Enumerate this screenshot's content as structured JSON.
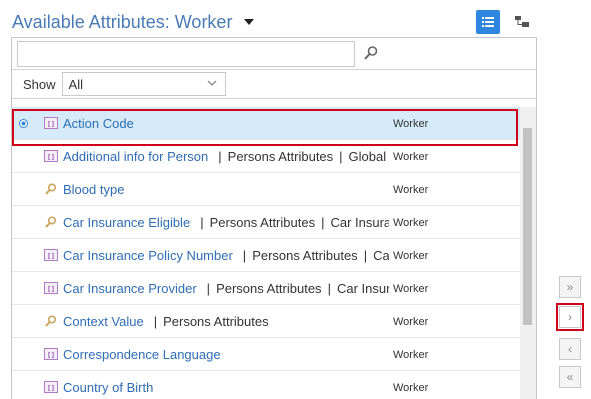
{
  "header": {
    "title": "Available Attributes: Worker",
    "list_view_icon": "list-view-icon",
    "tree_view_icon": "hierarchy-view-icon"
  },
  "search": {
    "value": "",
    "placeholder": "",
    "icon": "search-icon"
  },
  "filter": {
    "show_label": "Show",
    "show_value": "All"
  },
  "rows": [
    {
      "name": "Action Code",
      "details": [],
      "owner": "Worker",
      "icon": "attribute-icon",
      "selected": true
    },
    {
      "name": "Additional info for Person",
      "details": [
        "Persons Attributes",
        "Global D"
      ],
      "owner": "Worker",
      "icon": "attribute-icon",
      "selected": false
    },
    {
      "name": "Blood type",
      "details": [],
      "owner": "Worker",
      "icon": "lookup-search-icon",
      "selected": false
    },
    {
      "name": "Car Insurance Eligible",
      "details": [
        "Persons Attributes",
        "Car Insuranc"
      ],
      "owner": "Worker",
      "icon": "lookup-search-icon",
      "selected": false
    },
    {
      "name": "Car Insurance Policy Number",
      "details": [
        "Persons Attributes",
        "Car In"
      ],
      "owner": "Worker",
      "icon": "attribute-icon",
      "selected": false
    },
    {
      "name": "Car Insurance Provider",
      "details": [
        "Persons Attributes",
        "Car Insuran"
      ],
      "owner": "Worker",
      "icon": "attribute-icon",
      "selected": false
    },
    {
      "name": "Context Value",
      "details": [
        "Persons Attributes"
      ],
      "owner": "Worker",
      "icon": "lookup-search-icon",
      "selected": false
    },
    {
      "name": "Correspondence Language",
      "details": [],
      "owner": "Worker",
      "icon": "attribute-icon",
      "selected": false
    },
    {
      "name": "Country of Birth",
      "details": [],
      "owner": "Worker",
      "icon": "attribute-icon",
      "selected": false
    }
  ],
  "shuttle": {
    "move_all_right": "»",
    "move_right": "›",
    "move_left": "‹",
    "move_all_left": "«"
  },
  "colors": {
    "title": "#4a7ab5",
    "link": "#2f6db5",
    "selected_row": "#d6ebfa",
    "highlight_border": "#d0021b",
    "accent": "#2e86de"
  }
}
